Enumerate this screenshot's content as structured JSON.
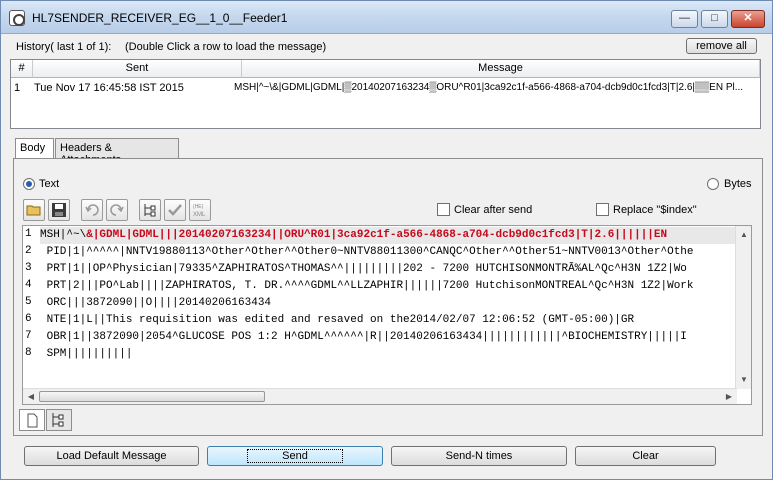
{
  "window": {
    "title": "HL7SENDER_RECEIVER_EG__1_0__Feeder1",
    "controls": {
      "minimize": "—",
      "maximize": "□",
      "close": "✕"
    }
  },
  "history": {
    "label": "History( last 1 of 1):",
    "hint": "(Double Click a row to load the message)",
    "remove_all_label": "remove all",
    "columns": [
      "#",
      "Sent",
      "Message"
    ],
    "rows": [
      {
        "index": "1",
        "sent": "Tue Nov 17 16:45:58 IST 2015",
        "message": "MSH|^~\\&|GDML|GDML|▒20140207163234▒ORU^R01|3ca92c1f-a566-4868-a704-dcb9d0c1fcd3|T|2.6|▒▒EN Pl..."
      }
    ]
  },
  "tabs": {
    "body": "Body",
    "headers": "Headers & Attachments"
  },
  "format": {
    "text_label": "Text",
    "bytes_label": "Bytes",
    "selected": "Text"
  },
  "options": {
    "clear_after_send_label": "Clear after send",
    "clear_after_send_checked": false,
    "replace_index_label": "Replace \"$index\"",
    "replace_index_checked": false
  },
  "toolbar": {
    "icons": [
      "open-folder-icon",
      "save-icon",
      "undo-icon",
      "redo-icon",
      "tree-view-icon",
      "validate-check-icon",
      "xml-convert-icon"
    ],
    "xml_icon_text": "XML"
  },
  "editor": {
    "first_line": {
      "number": "1",
      "plain": "MSH|^~\\",
      "highlighted": "&|GDML|GDML|||20140207163234||ORU^R01|3ca92c1f-a566-4868-a704-dcb9d0c1fcd3|T|2.6||||||EN"
    },
    "lines": [
      {
        "number": "2",
        "text": " PID|1|^^^^^|NNTV19880113^Other^Other^^Other0~NNTV88011300^CANQC^Other^^Other51~NNTV0013^Other^Othe"
      },
      {
        "number": "3",
        "text": " PRT|1||OP^Physician|79335^ZAPHIRATOS^THOMAS^^|||||||||202 - 7200 HUTCHISONMONTRÃ%AL^Qc^H3N 1Z2|Wo"
      },
      {
        "number": "4",
        "text": " PRT|2|||PO^Lab||||ZAPHIRATOS, T. DR.^^^^GDML^^LLZAPHIR||||||7200 HutchisonMONTREAL^Qc^H3N 1Z2|Work"
      },
      {
        "number": "5",
        "text": " ORC|||3872090||O||||20140206163434"
      },
      {
        "number": "6",
        "text": " NTE|1|L||This requisition was edited and resaved on the2014/02/07 12:06:52 (GMT-05:00)|GR"
      },
      {
        "number": "7",
        "text": " OBR|1||3872090|2054^GLUCOSE POS 1:2 H^GDML^^^^^^|R||20140206163434||||||||||||^BIOCHEMISTRY|||||I"
      },
      {
        "number": "8",
        "text": " SPM||||||||||"
      }
    ]
  },
  "bottom_tabs": [
    "text-view-icon",
    "tree-view-icon"
  ],
  "buttons": {
    "load_default": "Load Default Message",
    "send": "Send",
    "send_n": "Send-N times",
    "clear": "Clear"
  },
  "colors": {
    "segment_highlight": "#c8081c",
    "focus_border": "#3c7fb1"
  }
}
